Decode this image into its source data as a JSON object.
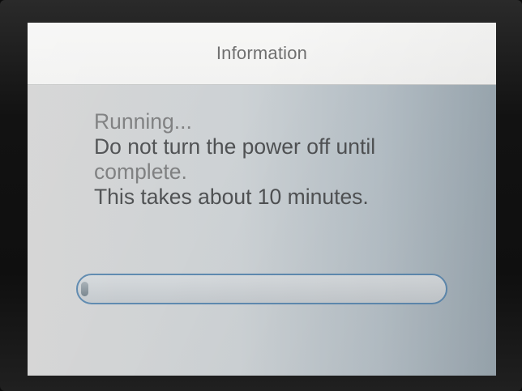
{
  "dialog": {
    "title": "Information",
    "message_lines": [
      "Running...",
      "Do not turn the power off until",
      "complete.",
      "This takes about 10 minutes."
    ]
  },
  "progress": {
    "value": 0.02
  },
  "colors": {
    "title_bar": "#f3f3f2",
    "title_text": "#6f6f6f",
    "message_text": "#7e7f80",
    "progress_border": "#5f8ab0"
  }
}
